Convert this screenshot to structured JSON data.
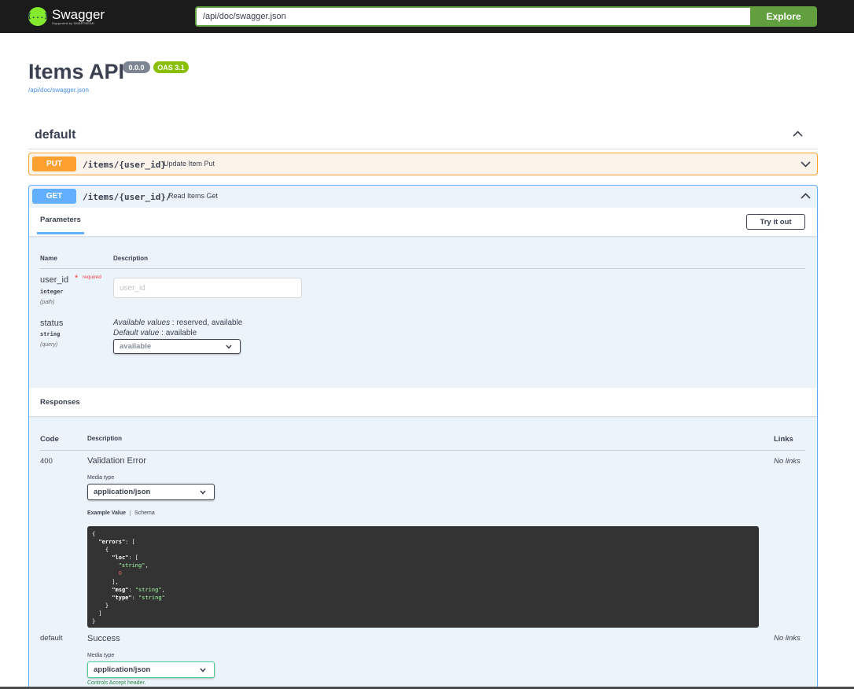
{
  "topbar": {
    "logo_name": "Swagger",
    "logo_sub": "Supported by SMARTBEAR",
    "logo_glyph": "{...}",
    "url_value": "/api/doc/swagger.json",
    "explore_label": "Explore"
  },
  "info": {
    "title": "Items API",
    "version": "0.0.0",
    "oas": "OAS 3.1",
    "spec_link": "/api/doc/swagger.json"
  },
  "tag": {
    "name": "default"
  },
  "operations": [
    {
      "method": "PUT",
      "path": "/items/{user_id}",
      "summary": "Update Item Put",
      "color": "#fca130"
    },
    {
      "method": "GET",
      "path": "/items/{user_id}/",
      "summary": "Read Items Get",
      "color": "#61affe"
    }
  ],
  "parameters": {
    "tab_label": "Parameters",
    "try_label": "Try it out",
    "col_name": "Name",
    "col_description": "Description",
    "items": [
      {
        "name": "user_id",
        "required_star": "*",
        "required_label": "required",
        "type": "integer",
        "in": "(path)",
        "placeholder": "user_id"
      },
      {
        "name": "status",
        "type": "string",
        "in": "(query)",
        "available_label": "Available values",
        "available_values": " : reserved, available",
        "default_label": "Default value",
        "default_value": " : available",
        "selected": "available"
      }
    ]
  },
  "responses": {
    "title": "Responses",
    "col_code": "Code",
    "col_description": "Description",
    "col_links": "Links",
    "media_type_label": "Media type",
    "items": [
      {
        "code": "400",
        "description": "Validation Error",
        "media_type": "application/json",
        "links": "No links",
        "example_tab": "Example Value",
        "schema_tab": "Schema"
      },
      {
        "code": "default",
        "description": "Success",
        "media_type": "application/json",
        "links": "No links",
        "controls_prefix": "Controls ",
        "controls_header": "Accept",
        "controls_suffix": " header."
      }
    ]
  },
  "example_json": {
    "open": "{",
    "errors_key": "\"errors\"",
    "loc_key": "\"loc\"",
    "string_val": "\"string\"",
    "zero_val": "0",
    "msg_key": "\"msg\"",
    "type_key": "\"type\""
  },
  "colors": {
    "topbar_bg": "#1b1b1b",
    "swagger_green": "#62a03f",
    "put": "#fca130",
    "get": "#61affe",
    "badge_version": "#7d8492",
    "badge_oas": "#89bf04"
  }
}
